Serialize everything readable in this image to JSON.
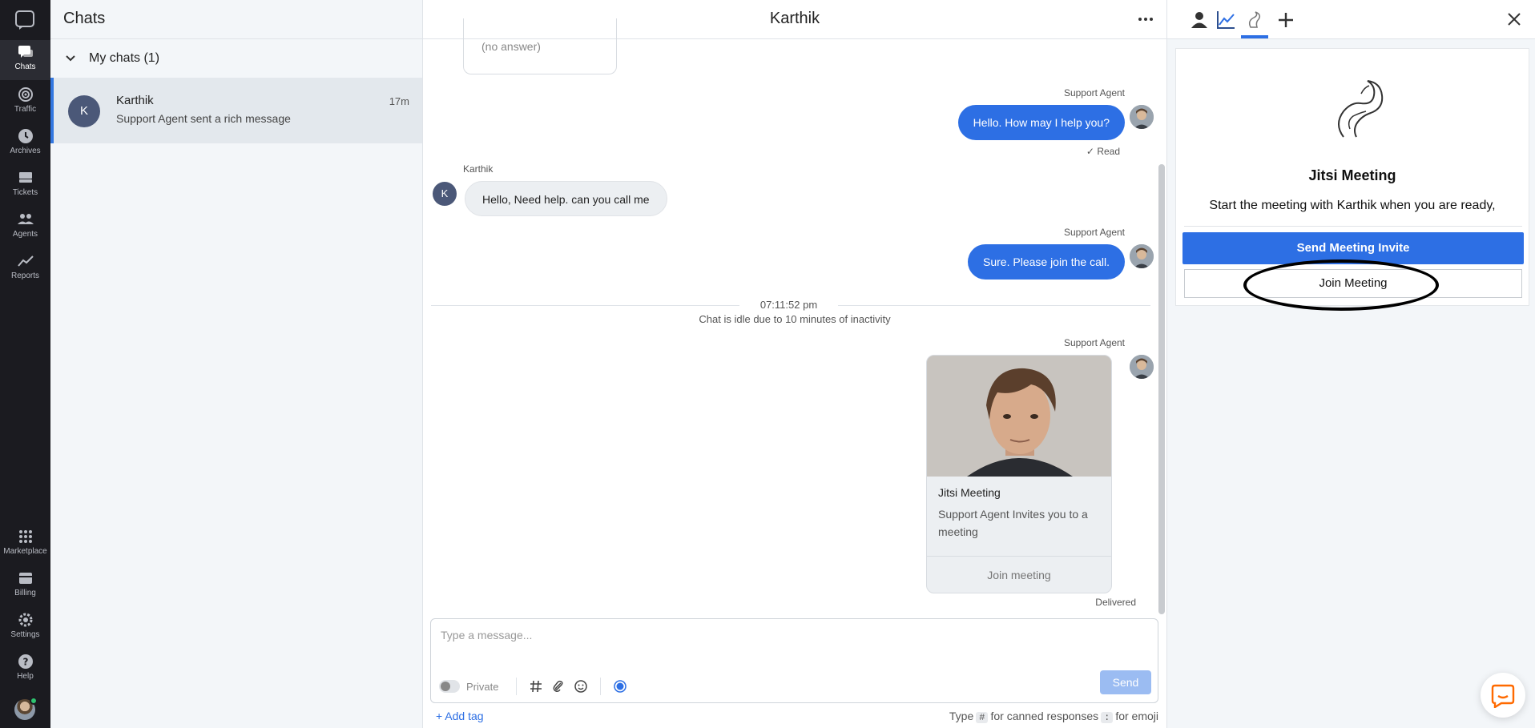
{
  "nav": {
    "items": [
      {
        "label": "Chats",
        "icon": "chat-icon",
        "active": true
      },
      {
        "label": "Traffic",
        "icon": "traffic-icon"
      },
      {
        "label": "Archives",
        "icon": "clock-icon"
      },
      {
        "label": "Tickets",
        "icon": "ticket-icon"
      },
      {
        "label": "Agents",
        "icon": "agents-icon"
      },
      {
        "label": "Reports",
        "icon": "chart-line-icon"
      },
      {
        "label": "Marketplace",
        "icon": "grid-icon"
      },
      {
        "label": "Billing",
        "icon": "billing-icon"
      },
      {
        "label": "Settings",
        "icon": "gear-icon"
      },
      {
        "label": "Help",
        "icon": "help-icon"
      }
    ]
  },
  "list": {
    "title": "Chats",
    "group_label": "My chats (1)",
    "chat": {
      "avatar_letter": "K",
      "name": "Karthik",
      "preview": "Support Agent sent a rich message",
      "time": "17m"
    }
  },
  "chat": {
    "title": "Karthik",
    "no_answer": "(no answer)",
    "messages": [
      {
        "author": "Support Agent",
        "text": "Hello. How may I help you?",
        "status": "Read"
      },
      {
        "author": "Karthik",
        "avatar_letter": "K",
        "text": "Hello, Need help. can you call me"
      },
      {
        "author": "Support Agent",
        "text": "Sure. Please join the call."
      },
      {
        "author": "Support Agent"
      }
    ],
    "separator_time": "07:11:52 pm",
    "idle_notice": "Chat is idle due to 10 minutes of inactivity",
    "card": {
      "title": "Jitsi Meeting",
      "subtitle": "Support Agent Invites you to a meeting",
      "button": "Join meeting"
    },
    "delivered": "Delivered",
    "composer": {
      "placeholder": "Type a message...",
      "private_label": "Private",
      "send_label": "Send"
    },
    "add_tag": "+ Add tag",
    "hint": {
      "type": "Type",
      "key1": "#",
      "canned": "for canned responses",
      "key2": ":",
      "emoji": "for emoji"
    }
  },
  "panel": {
    "widget": {
      "title": "Jitsi Meeting",
      "text": "Start the meeting with Karthik when you are ready,",
      "invite_button": "Send Meeting Invite",
      "join_button": "Join Meeting"
    }
  },
  "colors": {
    "accent": "#2d6fe4",
    "nav_bg": "#1b1b20"
  }
}
